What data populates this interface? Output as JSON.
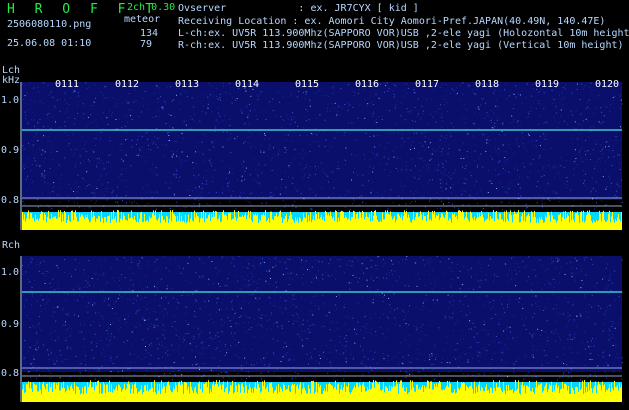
{
  "header": {
    "app_title": "H R O F F T",
    "version": "2ch 0.30",
    "filename": "2506080110.png",
    "datetime": "25.06.08 01:10",
    "meteor_label": "meteor",
    "meteor_count_lch": "134",
    "meteor_count_rch": "79",
    "observer_line": "Ovserver            : ex. JR7CYX [ kid ]",
    "location_line": "Receiving Location : ex. Aomori City Aomori-Pref.JAPAN(40.49N, 140.47E)",
    "lch_line": "L-ch:ex. UV5R 113.900Mhz(SAPPORO VOR)USB ,2-ele yagi (Holozontal 10m height",
    "rch_line": "R-ch:ex. UV5R 113.900Mhz(SAPPORO VOR)USB ,2-ele yagi (Vertical 10m height)"
  },
  "panels": {
    "lch": {
      "label": "Lch",
      "unit": "kHz",
      "ticks": [
        "1.0",
        "0.9",
        "0.8"
      ],
      "time_labels": [
        "0111",
        "0112",
        "0113",
        "0114",
        "0115",
        "0116",
        "0117",
        "0118",
        "0119",
        "0120"
      ]
    },
    "rch": {
      "label": "Rch",
      "ticks": [
        "1.0",
        "0.9",
        "0.8"
      ]
    }
  },
  "colors": {
    "background": "#000000",
    "spectrum_base": "#0a0f6b",
    "text": "#b8d8ff",
    "title_green": "#26e84a",
    "signal_line": "#3cc8c8",
    "level_yellow": "#ffff00",
    "level_cyan": "#00d8ff"
  }
}
